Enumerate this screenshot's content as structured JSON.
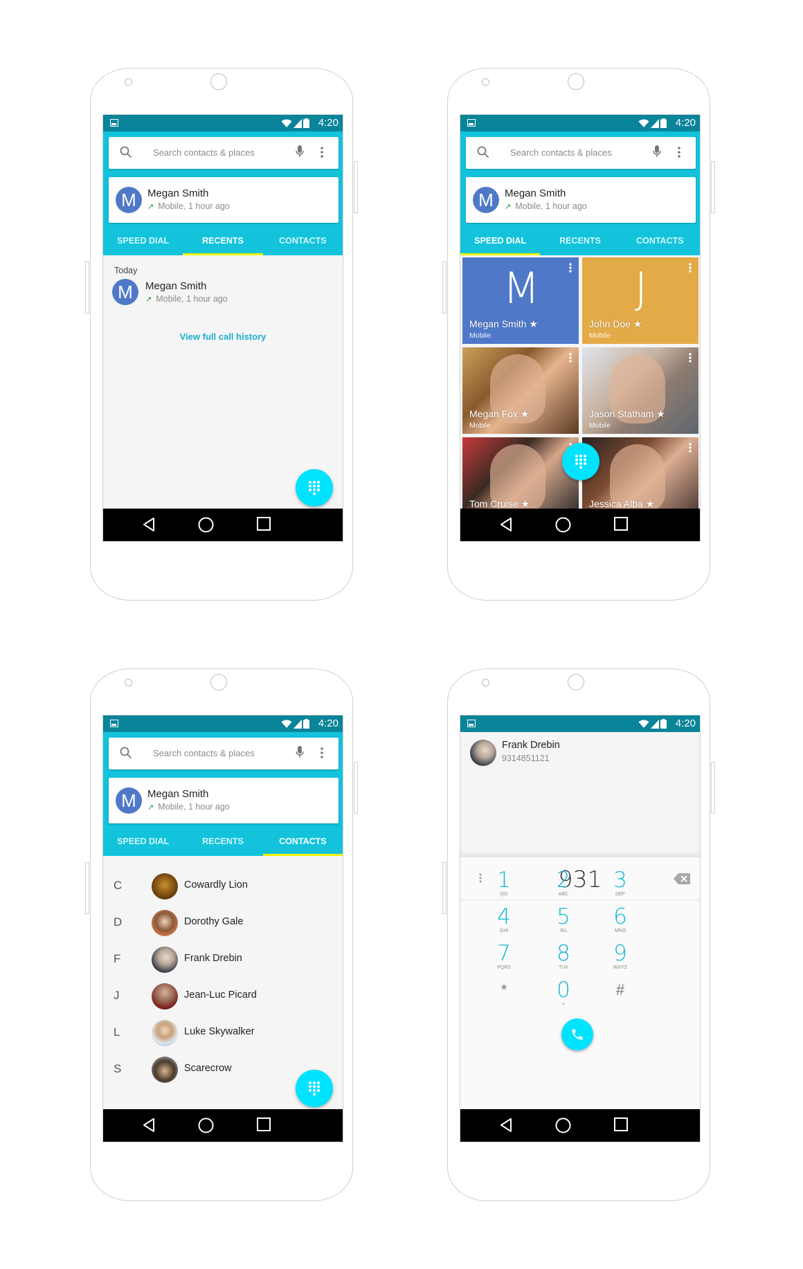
{
  "status_bar": {
    "time": "4:20"
  },
  "search": {
    "placeholder": "Search contacts & places"
  },
  "recent_card": {
    "avatar_letter": "M",
    "name": "Megan Smith",
    "subtitle": "Mobile, 1 hour ago"
  },
  "tabs": [
    {
      "label": "SPEED DIAL"
    },
    {
      "label": "RECENTS"
    },
    {
      "label": "CONTACTS"
    }
  ],
  "screens": {
    "recents": {
      "active_tab": "RECENTS",
      "section_header": "Today",
      "items": [
        {
          "avatar_letter": "M",
          "name": "Megan Smith",
          "subtitle": "Mobile, 1 hour ago"
        }
      ],
      "view_history_link": "View full call history"
    },
    "speed_dial": {
      "active_tab": "SPEED DIAL",
      "tiles": [
        {
          "name": "Megan Smith ★",
          "type": "Mobile",
          "letter": "M",
          "color": "#4f79c8"
        },
        {
          "name": "John Doe ★",
          "type": "Mobile",
          "letter": "J",
          "color": "#e3aa48"
        },
        {
          "name": "Megan Fox ★",
          "type": "Mobile",
          "photo": true
        },
        {
          "name": "Jason Statham ★",
          "type": "Mobile",
          "photo": true
        },
        {
          "name": "Tom Cruise ★",
          "type": "",
          "photo": true
        },
        {
          "name": "Jessica Alba ★",
          "type": "",
          "photo": true
        }
      ]
    },
    "contacts": {
      "active_tab": "CONTACTS",
      "items": [
        {
          "index": "C",
          "name": "Cowardly Lion"
        },
        {
          "index": "D",
          "name": "Dorothy Gale"
        },
        {
          "index": "F",
          "name": "Frank Drebin"
        },
        {
          "index": "J",
          "name": "Jean-Luc Picard"
        },
        {
          "index": "L",
          "name": "Luke Skywalker"
        },
        {
          "index": "S",
          "name": "Scarecrow"
        }
      ]
    },
    "dialer": {
      "suggestion": {
        "name": "Frank Drebin",
        "number": "9314851121"
      },
      "digits": "931",
      "keys": [
        {
          "num": "1",
          "letters": "QO"
        },
        {
          "num": "2",
          "letters": "ABC"
        },
        {
          "num": "3",
          "letters": "DEF"
        },
        {
          "num": "4",
          "letters": "GHI"
        },
        {
          "num": "5",
          "letters": "JKL"
        },
        {
          "num": "6",
          "letters": "MNO"
        },
        {
          "num": "7",
          "letters": "PQRS"
        },
        {
          "num": "8",
          "letters": "TUV"
        },
        {
          "num": "9",
          "letters": "WXYZ"
        },
        {
          "num": "*",
          "letters": ""
        },
        {
          "num": "0",
          "letters": "+"
        },
        {
          "num": "#",
          "letters": ""
        }
      ]
    }
  },
  "colors": {
    "status_bar": "#0a8499",
    "header": "#12c3db",
    "tab_indicator": "#f2f300",
    "fab": "#00e3ff",
    "avatar": "#4f79c8",
    "link": "#1aaed0",
    "outgoing_arrow": "#1e9a3a"
  }
}
